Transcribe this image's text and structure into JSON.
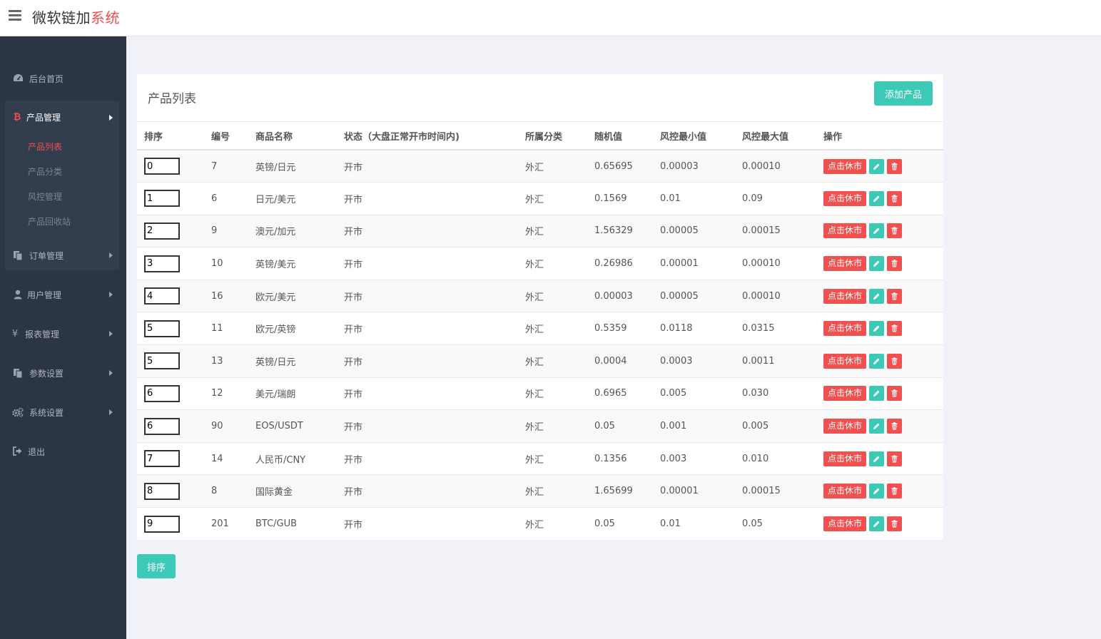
{
  "app": {
    "title_main": "微软链加",
    "title_accent": "系统"
  },
  "sidebar": {
    "home": "后台首页",
    "product_group": {
      "label": "产品管理",
      "subitems": [
        "产品列表",
        "产品分类",
        "风控管理",
        "产品回收站"
      ]
    },
    "items": [
      {
        "label": "订单管理",
        "icon": "files-icon"
      },
      {
        "label": "用户管理",
        "icon": "user-icon"
      },
      {
        "label": "报表管理",
        "icon": "yen-icon"
      },
      {
        "label": "参数设置",
        "icon": "files-icon"
      },
      {
        "label": "系统设置",
        "icon": "gears-icon"
      }
    ],
    "logout": "退出",
    "product_icon_glyph": "₿",
    "yen_glyph": "¥"
  },
  "card": {
    "title": "产品列表",
    "add_button": "添加产品"
  },
  "table": {
    "headers": [
      "排序",
      "编号",
      "商品名称",
      "状态（大盘正常开市时间内)",
      "所属分类",
      "随机值",
      "风控最小值",
      "风控最大值",
      "操作"
    ],
    "action_label": "点击休市",
    "rows": [
      [
        "0",
        "7",
        "英镑/日元",
        "开市",
        "外汇",
        "0.65695",
        "0.00003",
        "0.00010"
      ],
      [
        "1",
        "6",
        "日元/美元",
        "开市",
        "外汇",
        "0.1569",
        "0.01",
        "0.09"
      ],
      [
        "2",
        "9",
        "澳元/加元",
        "开市",
        "外汇",
        "1.56329",
        "0.00005",
        "0.00015"
      ],
      [
        "3",
        "10",
        "英镑/美元",
        "开市",
        "外汇",
        "0.26986",
        "0.00001",
        "0.00010"
      ],
      [
        "4",
        "16",
        "欧元/美元",
        "开市",
        "外汇",
        "0.00003",
        "0.00005",
        "0.00010"
      ],
      [
        "5",
        "11",
        "欧元/英镑",
        "开市",
        "外汇",
        "0.5359",
        "0.0118",
        "0.0315"
      ],
      [
        "5",
        "13",
        "英镑/日元",
        "开市",
        "外汇",
        "0.0004",
        "0.0003",
        "0.0011"
      ],
      [
        "6",
        "12",
        "美元/瑞朗",
        "开市",
        "外汇",
        "0.6965",
        "0.005",
        "0.030"
      ],
      [
        "6",
        "90",
        "EOS/USDT",
        "开市",
        "外汇",
        "0.05",
        "0.001",
        "0.005"
      ],
      [
        "7",
        "14",
        "人民币/CNY",
        "开市",
        "外汇",
        "0.1356",
        "0.003",
        "0.010"
      ],
      [
        "8",
        "8",
        "国际黄金",
        "开市",
        "外汇",
        "1.65699",
        "0.00001",
        "0.00015"
      ],
      [
        "9",
        "201",
        "BTC/GUB",
        "开市",
        "外汇",
        "0.05",
        "0.01",
        "0.05"
      ]
    ]
  },
  "footer": {
    "sort_button": "排序"
  },
  "colors": {
    "accent_red": "#f05050",
    "accent_teal": "#3cc9b6",
    "sidebar_bg": "#2b3544"
  }
}
